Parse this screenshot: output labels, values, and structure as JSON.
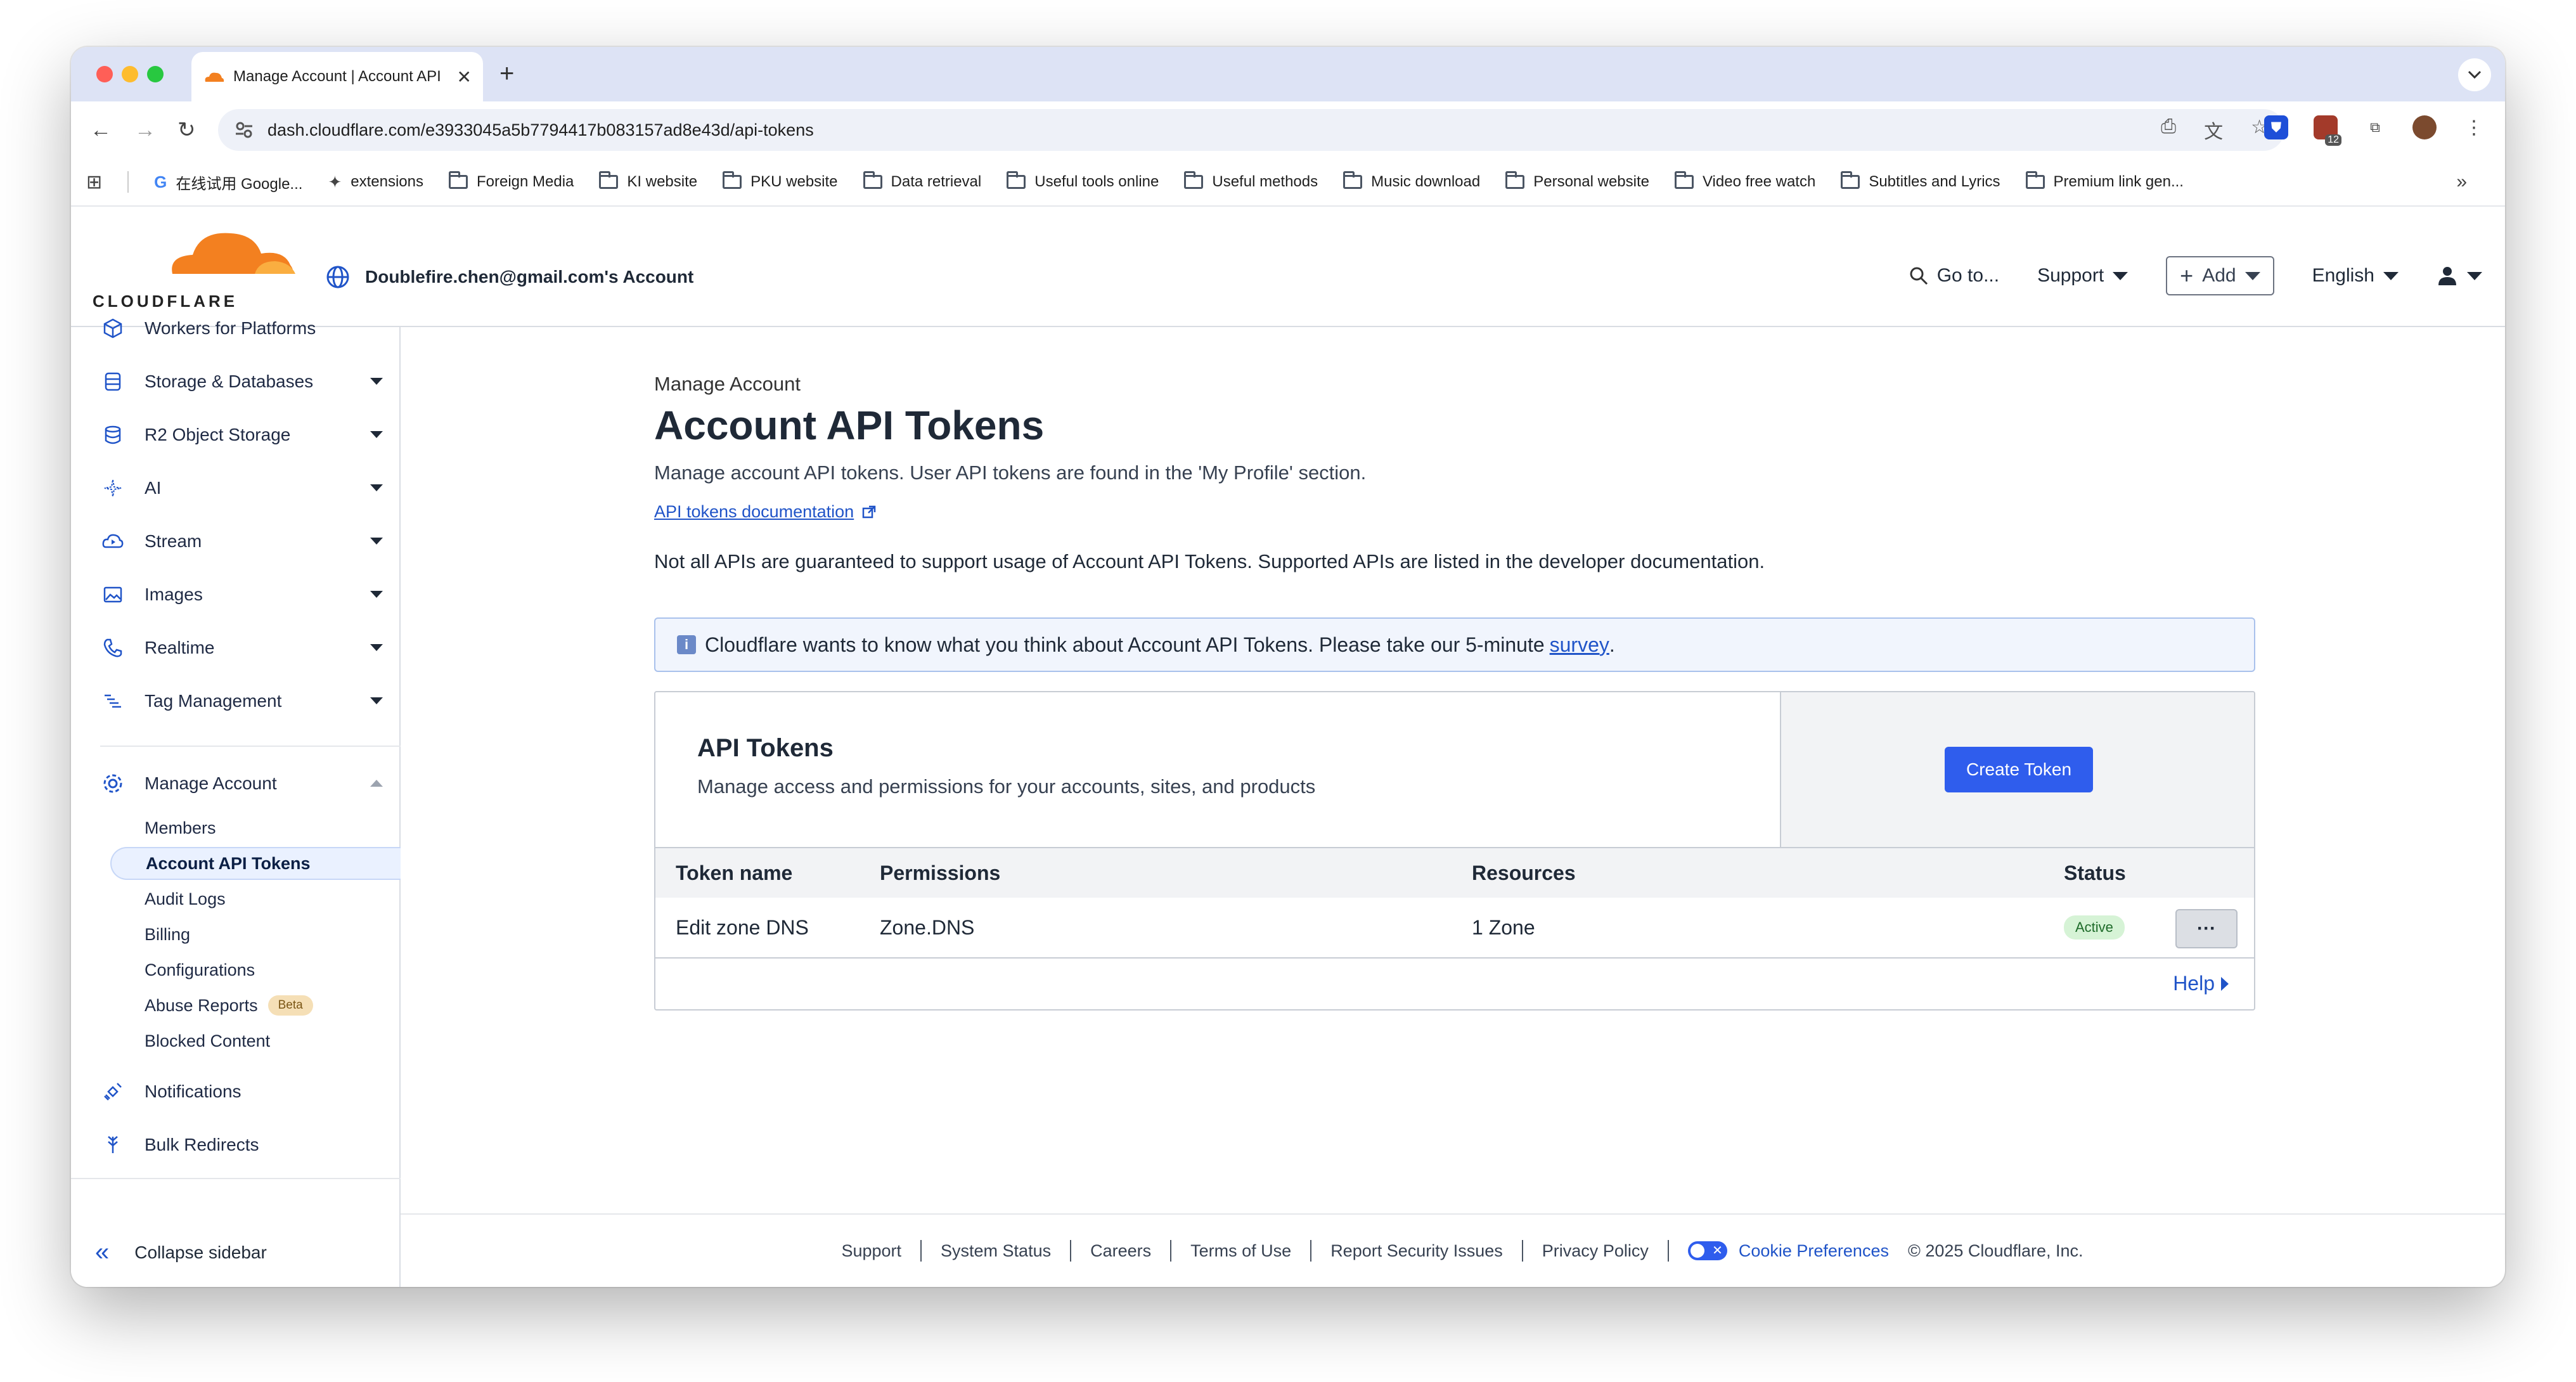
{
  "browser": {
    "tab_title": "Manage Account | Account API Tokens",
    "url": "dash.cloudflare.com/e3933045a5b7794417b083157ad8e43d/api-tokens",
    "bookmarks": [
      {
        "label": "在线试用 Google...",
        "icon": "google-icon"
      },
      {
        "label": "extensions",
        "icon": "puzzle-icon"
      },
      {
        "label": "Foreign Media",
        "icon": "folder-icon"
      },
      {
        "label": "KI website",
        "icon": "folder-icon"
      },
      {
        "label": "PKU website",
        "icon": "folder-icon"
      },
      {
        "label": "Data retrieval",
        "icon": "folder-icon"
      },
      {
        "label": "Useful tools online",
        "icon": "folder-icon"
      },
      {
        "label": "Useful methods",
        "icon": "folder-icon"
      },
      {
        "label": "Music download",
        "icon": "folder-icon"
      },
      {
        "label": "Personal website",
        "icon": "folder-icon"
      },
      {
        "label": "Video free watch",
        "icon": "folder-icon"
      },
      {
        "label": "Subtitles and Lyrics",
        "icon": "folder-icon"
      },
      {
        "label": "Premium link gen...",
        "icon": "folder-icon"
      }
    ],
    "extension_badge": "12"
  },
  "header": {
    "logo_text": "CLOUDFLARE",
    "account_name": "Doublefire.chen@gmail.com's Account",
    "goto_label": "Go to...",
    "support_label": "Support",
    "add_label": "Add",
    "language_label": "English"
  },
  "sidebar": {
    "items": [
      {
        "label": "Workers for Platforms",
        "icon": "cube-icon",
        "caret": false
      },
      {
        "label": "Storage & Databases",
        "icon": "database-icon",
        "caret": true
      },
      {
        "label": "R2 Object Storage",
        "icon": "storage-icon",
        "caret": true
      },
      {
        "label": "AI",
        "icon": "sparkle-icon",
        "caret": true
      },
      {
        "label": "Stream",
        "icon": "cloud-play-icon",
        "caret": true
      },
      {
        "label": "Images",
        "icon": "image-icon",
        "caret": true
      },
      {
        "label": "Realtime",
        "icon": "phone-icon",
        "caret": true
      },
      {
        "label": "Tag Management",
        "icon": "tag-list-icon",
        "caret": true
      }
    ],
    "manage_account": {
      "label": "Manage Account",
      "icon": "gear-icon",
      "sub_items": [
        {
          "label": "Members"
        },
        {
          "label": "Account API Tokens"
        },
        {
          "label": "Audit Logs"
        },
        {
          "label": "Billing"
        },
        {
          "label": "Configurations"
        },
        {
          "label": "Abuse Reports",
          "badge": "Beta"
        },
        {
          "label": "Blocked Content"
        }
      ]
    },
    "bottom_items": [
      {
        "label": "Notifications",
        "icon": "satellite-icon"
      },
      {
        "label": "Bulk Redirects",
        "icon": "redirect-icon"
      }
    ],
    "collapse_label": "Collapse sidebar"
  },
  "main": {
    "eyebrow": "Manage Account",
    "title": "Account API Tokens",
    "description": "Manage account API tokens. User API tokens are found in the 'My Profile' section.",
    "doc_link": "API tokens documentation",
    "note": "Not all APIs are guaranteed to support usage of Account API Tokens. Supported APIs are listed in the developer documentation.",
    "banner_text": "Cloudflare wants to know what you think about Account API Tokens. Please take our 5-minute",
    "banner_link": "survey",
    "banner_end": ".",
    "card": {
      "title": "API Tokens",
      "subtitle": "Manage access and permissions for your accounts, sites, and products",
      "create_button": "Create Token",
      "columns": [
        "Token name",
        "Permissions",
        "Resources",
        "Status"
      ],
      "rows": [
        {
          "name": "Edit zone DNS",
          "permissions": "Zone.DNS",
          "resources": "1 Zone",
          "status": "Active"
        }
      ],
      "more_label": "···",
      "help_label": "Help"
    }
  },
  "footer": {
    "links": [
      "Support",
      "System Status",
      "Careers",
      "Terms of Use",
      "Report Security Issues",
      "Privacy Policy"
    ],
    "cookie_label": "Cookie Preferences",
    "copyright": "© 2025 Cloudflare, Inc."
  },
  "colors": {
    "accent": "#2f5ded",
    "link": "#2054c8",
    "logo_orange": "#f38020",
    "active_green": "#1e6b2a"
  }
}
